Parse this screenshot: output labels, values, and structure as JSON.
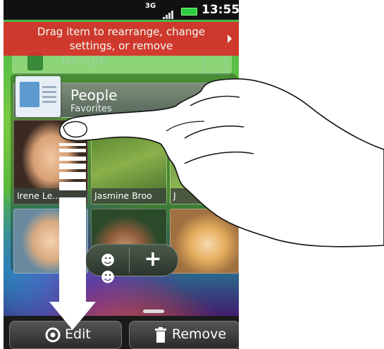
{
  "status_bar": {
    "network": "3G",
    "time": "13:55"
  },
  "banner": {
    "line1": "Drag item to rearrange, change",
    "line2": "settings, or remove"
  },
  "search": {
    "placeholder": "Google"
  },
  "people_widget": {
    "title": "People",
    "subtitle": "Favorites",
    "contacts": [
      {
        "name": "Irene Le..."
      },
      {
        "name": "Jasmine Broo"
      },
      {
        "name": "J"
      }
    ]
  },
  "bottom_bar": {
    "edit_label": "Edit",
    "remove_label": "Remove"
  },
  "colors": {
    "banner": "#d9302b",
    "arrow": "#ffffff"
  }
}
